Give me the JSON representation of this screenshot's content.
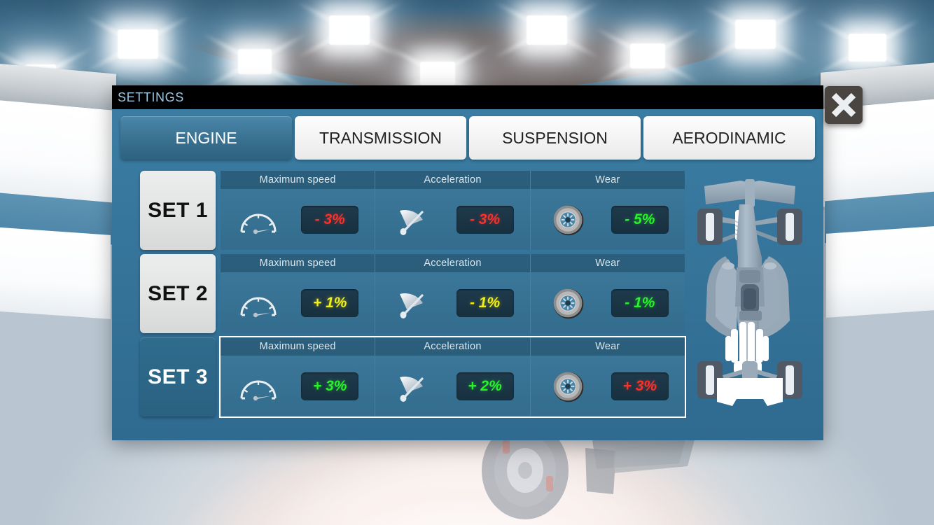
{
  "window": {
    "title": "SETTINGS",
    "close_label": "✕"
  },
  "tabs": [
    {
      "label": "ENGINE",
      "active": true
    },
    {
      "label": "TRANSMISSION",
      "active": false
    },
    {
      "label": "SUSPENSION",
      "active": false
    },
    {
      "label": "AERODINAMIC",
      "active": false
    }
  ],
  "columns": [
    {
      "label": "Maximum speed",
      "icon": "speedometer-icon"
    },
    {
      "label": "Acceleration",
      "icon": "acceleration-needle-icon"
    },
    {
      "label": "Wear",
      "icon": "tire-icon"
    }
  ],
  "sets": [
    {
      "name": "SET 1",
      "selected": false,
      "values": [
        {
          "text": "- 3%",
          "color": "red"
        },
        {
          "text": "- 3%",
          "color": "red"
        },
        {
          "text": "- 5%",
          "color": "green"
        }
      ]
    },
    {
      "name": "SET 2",
      "selected": false,
      "values": [
        {
          "text": "+ 1%",
          "color": "yellow"
        },
        {
          "text": "- 1%",
          "color": "yellow"
        },
        {
          "text": "- 1%",
          "color": "green"
        }
      ]
    },
    {
      "name": "SET 3",
      "selected": true,
      "values": [
        {
          "text": "+ 3%",
          "color": "green"
        },
        {
          "text": "+ 2%",
          "color": "green"
        },
        {
          "text": "+ 3%",
          "color": "red"
        }
      ]
    }
  ],
  "car_preview": {
    "name": "f1-car-top-view"
  },
  "colors": {
    "panel_blue": "#36749a",
    "tab_active": "#39708f",
    "value_red": "#f8312a",
    "value_green": "#27f427",
    "value_yellow": "#f2ef16",
    "title_text": "#9ec6e0"
  }
}
